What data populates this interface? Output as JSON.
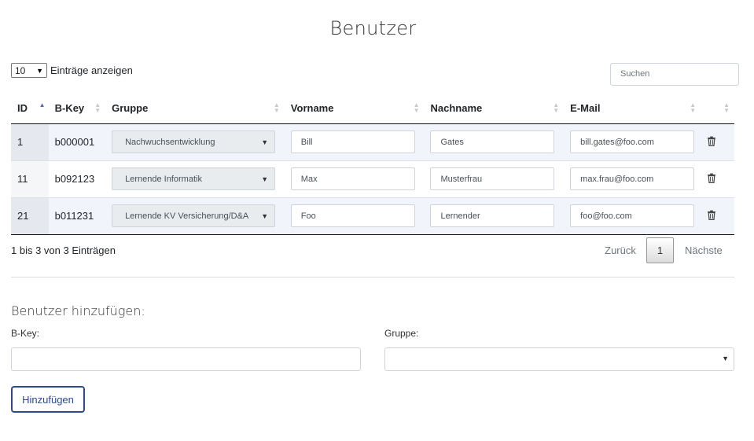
{
  "page": {
    "title": "Benutzer"
  },
  "table_controls": {
    "length_value": "10",
    "length_label": "Einträge anzeigen",
    "search_placeholder": "Suchen"
  },
  "table": {
    "headers": [
      "ID",
      "B-Key",
      "Gruppe",
      "Vorname",
      "Nachname",
      "E-Mail"
    ],
    "rows": [
      {
        "id": "1",
        "bkey": "b000001",
        "gruppe": "Nachwuchsentwicklung",
        "vorname": "Bill",
        "nachname": "Gates",
        "email": "bill.gates@foo.com"
      },
      {
        "id": "11",
        "bkey": "b092123",
        "gruppe": "Lernende Informatik",
        "vorname": "Max",
        "nachname": "Musterfrau",
        "email": "max.frau@foo.com"
      },
      {
        "id": "21",
        "bkey": "b011231",
        "gruppe": "Lernende KV Versicherung/D&A",
        "vorname": "Foo",
        "nachname": "Lernender",
        "email": "foo@foo.com"
      }
    ],
    "info": "1 bis 3 von 3 Einträgen",
    "pagination": {
      "prev": "Zurück",
      "current": "1",
      "next": "Nächste"
    }
  },
  "add_form": {
    "title": "Benutzer hinzufügen:",
    "bkey_label": "B-Key:",
    "gruppe_label": "Gruppe:",
    "submit_label": "Hinzufügen"
  },
  "colors": {
    "accent": "#2c4a8c",
    "sort_active": "#4d6ab5",
    "row_stripe": "#f2f4fb"
  }
}
